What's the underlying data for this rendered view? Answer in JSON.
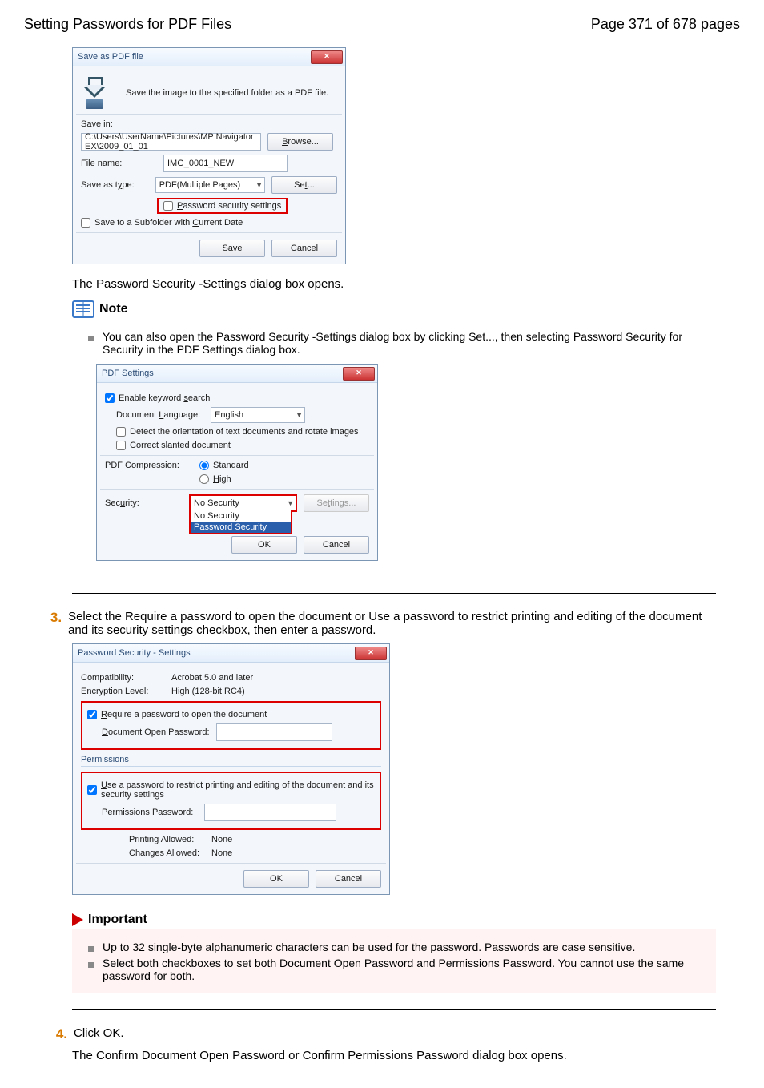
{
  "header": {
    "title": "Setting Passwords for PDF Files",
    "page_indicator": "Page 371 of 678 pages"
  },
  "dlg_save_pdf": {
    "title": "Save as PDF file",
    "desc": "Save the image to the specified folder as a PDF file.",
    "save_in_label": "Save in:",
    "save_in_path": "C:\\Users\\UserName\\Pictures\\MP Navigator EX\\2009_01_01",
    "browse": "Browse...",
    "file_name_label": "File name:",
    "file_name": "IMG_0001_NEW",
    "type_label": "Save as type:",
    "type_value": "PDF(Multiple Pages)",
    "set": "Set...",
    "pw_settings": "Password security settings",
    "subfolder": "Save to a Subfolder with Current Date",
    "save": "Save",
    "cancel": "Cancel"
  },
  "text_after_save": "The Password Security -Settings dialog box opens.",
  "note": {
    "title": "Note",
    "line1": "You can also open the Password Security -Settings dialog box by clicking Set..., then selecting Password Security for Security in the PDF Settings dialog box."
  },
  "dlg_pdf_settings": {
    "title": "PDF Settings",
    "enable_kw": "Enable keyword search",
    "doc_lang_label": "Document Language:",
    "doc_lang_value": "English",
    "detect_orient": "Detect the orientation of text documents and rotate images",
    "correct_slanted": "Correct slanted document",
    "compression_label": "PDF Compression:",
    "std": "Standard",
    "high": "High",
    "security_label": "Security:",
    "no_security": "No Security",
    "no_security_opt": "No Security",
    "password_security": "Password Security",
    "settings": "Settings...",
    "ok": "OK",
    "cancel": "Cancel"
  },
  "step3": {
    "num": "3.",
    "text": "Select the Require a password to open the document or Use a password to restrict printing and editing of the document and its security settings checkbox, then enter a password."
  },
  "dlg_pw": {
    "title": "Password Security - Settings",
    "compat_label": "Compatibility:",
    "compat_value": "Acrobat 5.0 and later",
    "enc_label": "Encryption Level:",
    "enc_value": "High (128-bit RC4)",
    "require_open": "Require a password to open the document",
    "doc_open_pw_label": "Document Open Password:",
    "permissions_hdr": "Permissions",
    "use_restrict": "Use a password to restrict printing and editing of the document and its security settings",
    "perm_pw_label": "Permissions Password:",
    "printing_label": "Printing Allowed:",
    "printing_value": "None",
    "changes_label": "Changes Allowed:",
    "changes_value": "None",
    "ok": "OK",
    "cancel": "Cancel"
  },
  "important": {
    "title": "Important",
    "b1": "Up to 32 single-byte alphanumeric characters can be used for the password. Passwords are case sensitive.",
    "b2": "Select both checkboxes to set both Document Open Password and Permissions Password. You cannot use the same password for both."
  },
  "step4": {
    "num": "4.",
    "text": "Click OK.",
    "after": "The Confirm Document Open Password or Confirm Permissions Password dialog box opens."
  }
}
